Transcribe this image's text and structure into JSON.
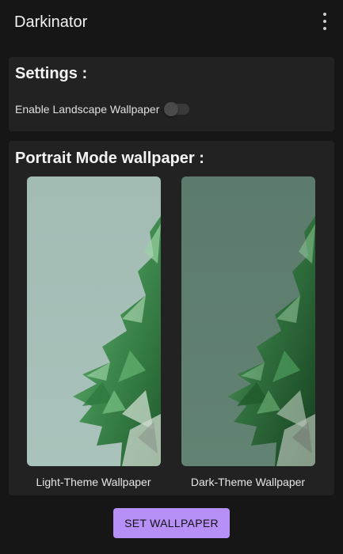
{
  "app": {
    "title": "Darkinator"
  },
  "settings": {
    "title": "Settings :",
    "landscape_toggle": {
      "label": "Enable Landscape Wallpaper",
      "checked": false
    }
  },
  "portrait": {
    "title": "Portrait Mode wallpaper :",
    "light": {
      "caption": "Light-Theme Wallpaper",
      "background_color": "#a6bfb8"
    },
    "dark": {
      "caption": "Dark-Theme Wallpaper",
      "background_color": "#5f7f70"
    }
  },
  "actions": {
    "set_wallpaper_label": "SET WALLPAPER"
  },
  "theme": {
    "background": "#161616",
    "card": "#222222",
    "accent": "#b68ff7",
    "crystal_green": "#3f8f4f"
  },
  "icons": {
    "overflow": "more-vert-icon"
  }
}
